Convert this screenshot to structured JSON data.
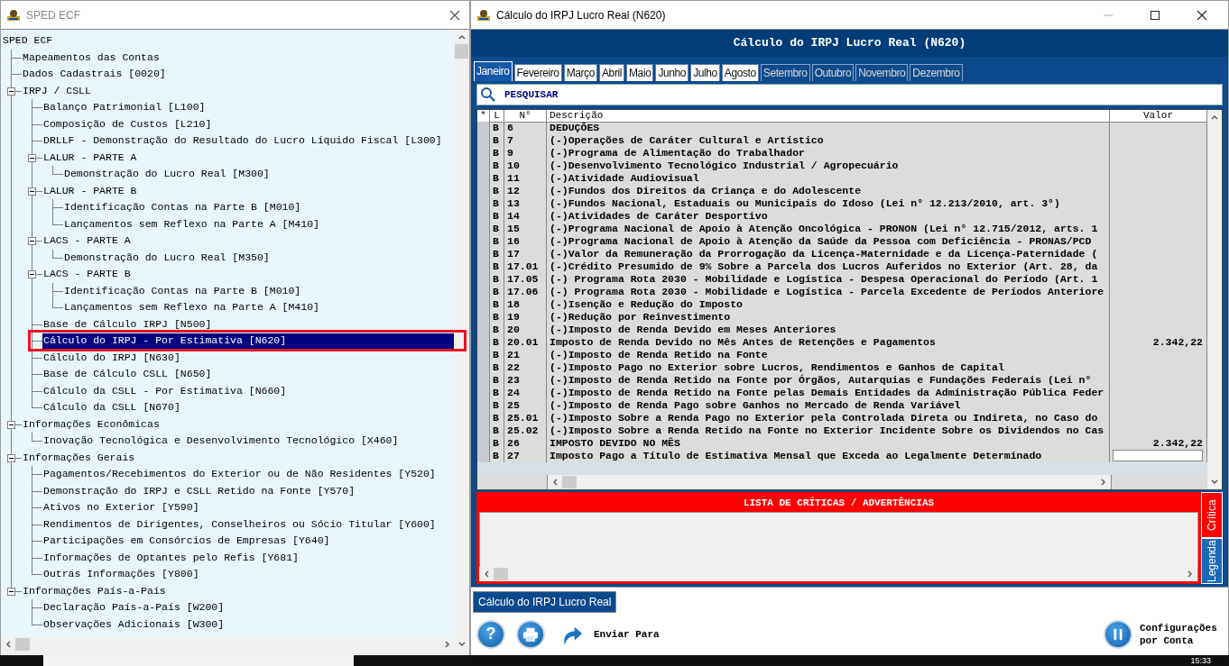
{
  "left_window": {
    "title": "SPED ECF",
    "tree": [
      {
        "label": "SPED ECF",
        "selected": false,
        "children": [
          {
            "label": "Mapeamentos das Contas",
            "selected": false
          },
          {
            "label": "Dados Cadastrais [0020]",
            "selected": false
          },
          {
            "label": "IRPJ / CSLL",
            "selected": false,
            "expanded": true,
            "children": [
              {
                "label": "Balanço Patrimonial [L100]",
                "selected": false
              },
              {
                "label": "Composição de Custos [L210]",
                "selected": false
              },
              {
                "label": "DRLLF - Demonstração do Resultado do Lucro Líquido Fiscal [L300]",
                "selected": false
              },
              {
                "label": "LALUR - PARTE A",
                "selected": false,
                "expanded": true,
                "children": [
                  {
                    "label": "Demonstração do Lucro Real [M300]",
                    "selected": false
                  }
                ]
              },
              {
                "label": "LALUR - PARTE B",
                "selected": false,
                "expanded": true,
                "children": [
                  {
                    "label": "Identificação Contas na Parte B [M010]",
                    "selected": false
                  },
                  {
                    "label": "Lançamentos sem Reflexo na Parte A [M410]",
                    "selected": false
                  }
                ]
              },
              {
                "label": "LACS - PARTE A",
                "selected": false,
                "expanded": true,
                "children": [
                  {
                    "label": "Demonstração do Lucro Real [M350]",
                    "selected": false
                  }
                ]
              },
              {
                "label": "LACS - PARTE B",
                "selected": false,
                "expanded": true,
                "children": [
                  {
                    "label": "Identificação Contas na Parte B [M010]",
                    "selected": false
                  },
                  {
                    "label": "Lançamentos sem Reflexo na Parte A [M410]",
                    "selected": false
                  }
                ]
              },
              {
                "label": "Base de Cálculo IRPJ [N500]",
                "selected": false
              },
              {
                "label": "Cálculo do IRPJ - Por Estimativa [N620]",
                "selected": true
              },
              {
                "label": "Cálculo do IRPJ [N630]",
                "selected": false
              },
              {
                "label": "Base de Cálculo CSLL [N650]",
                "selected": false
              },
              {
                "label": "Cálculo da CSLL - Por Estimativa [N660]",
                "selected": false
              },
              {
                "label": "Cálculo da CSLL [N670]",
                "selected": false
              }
            ]
          },
          {
            "label": "Informações Econômicas",
            "selected": false,
            "expanded": true,
            "children": [
              {
                "label": "Inovação Tecnológica e Desenvolvimento Tecnológico [X460]",
                "selected": false
              }
            ]
          },
          {
            "label": "Informações Gerais",
            "selected": false,
            "expanded": true,
            "children": [
              {
                "label": "Pagamentos/Recebimentos do Exterior ou de Não Residentes [Y520]",
                "selected": false
              },
              {
                "label": "Demonstração do IRPJ e CSLL Retido na Fonte [Y570]",
                "selected": false
              },
              {
                "label": "Ativos no Exterior [Y590]",
                "selected": false
              },
              {
                "label": "Rendimentos de Dirigentes, Conselheiros ou Sócio Titular [Y600]",
                "selected": false
              },
              {
                "label": "Participações em Consórcios de Empresas [Y640]",
                "selected": false
              },
              {
                "label": "Informações de Optantes pelo Refis [Y681]",
                "selected": false
              },
              {
                "label": "Outras Informações [Y800]",
                "selected": false
              }
            ]
          },
          {
            "label": "Informações País-a-País",
            "selected": false,
            "expanded": true,
            "children": [
              {
                "label": "Declaração País-a-País [W200]",
                "selected": false
              },
              {
                "label": "Observações Adicionais [W300]",
                "selected": false
              }
            ]
          }
        ]
      }
    ]
  },
  "right_window": {
    "title": "Cálculo do IRPJ Lucro Real (N620)",
    "header": "Cálculo do IRPJ Lucro Real (N620)",
    "tabs": [
      {
        "label": "Janeiro",
        "selected": true,
        "disabled": false
      },
      {
        "label": "Fevereiro",
        "selected": false,
        "disabled": false
      },
      {
        "label": "Março",
        "selected": false,
        "disabled": false
      },
      {
        "label": "Abril",
        "selected": false,
        "disabled": false
      },
      {
        "label": "Maio",
        "selected": false,
        "disabled": false
      },
      {
        "label": "Junho",
        "selected": false,
        "disabled": false
      },
      {
        "label": "Julho",
        "selected": false,
        "disabled": false
      },
      {
        "label": "Agosto",
        "selected": false,
        "disabled": false
      },
      {
        "label": "Setembro",
        "selected": false,
        "disabled": true
      },
      {
        "label": "Outubro",
        "selected": false,
        "disabled": true
      },
      {
        "label": "Novembro",
        "selected": false,
        "disabled": true
      },
      {
        "label": "Dezembro",
        "selected": false,
        "disabled": true
      }
    ],
    "search": {
      "placeholder": "PESQUISAR"
    },
    "table": {
      "columns": [
        "*",
        "L",
        "N°",
        "Descrição",
        "Valor"
      ],
      "rows": [
        {
          "kind": "text",
          "l": "B",
          "number": "6",
          "description": "DEDUÇÕES"
        },
        {
          "kind": "text",
          "l": "B",
          "number": "7",
          "description": "(-)Operações de Caráter Cultural e Artístico"
        },
        {
          "kind": "text",
          "l": "B",
          "number": "9",
          "description": "(-)Programa de Alimentação do Trabalhador"
        },
        {
          "kind": "text",
          "l": "B",
          "number": "10",
          "description": "(-)Desenvolvimento Tecnológico Industrial / Agropecuário"
        },
        {
          "kind": "text",
          "l": "B",
          "number": "11",
          "description": "(-)Atividade Audiovisual"
        },
        {
          "kind": "text",
          "l": "B",
          "number": "12",
          "description": "(-)Fundos dos Direitos da Criança e do Adolescente"
        },
        {
          "kind": "text",
          "l": "B",
          "number": "13",
          "description": "(-)Fundos Nacional, Estaduais ou Municipais do Idoso (Lei n° 12.213/2010, art. 3°)"
        },
        {
          "kind": "text",
          "l": "B",
          "number": "14",
          "description": "(-)Atividades de Caráter Desportivo"
        },
        {
          "kind": "text",
          "l": "B",
          "number": "15",
          "description": "(-)Programa Nacional de Apoio à Atenção Oncológica - PRONON (Lei n° 12.715/2012, arts. 1"
        },
        {
          "kind": "text",
          "l": "B",
          "number": "16",
          "description": "(-)Programa Nacional de Apoio à Atenção da Saúde da Pessoa com Deficiência - PRONAS/PCD"
        },
        {
          "kind": "text",
          "l": "B",
          "number": "17",
          "description": "(-)Valor da Remuneração da Prorrogação da Licença-Maternidade e da Licença-Paternidade ("
        },
        {
          "kind": "text",
          "l": "B",
          "number": "17.01",
          "description": "(-)Crédito Presumido de 9% Sobre a Parcela dos Lucros Auferidos no Exterior (Art. 28, da"
        },
        {
          "kind": "text",
          "l": "B",
          "number": "17.05",
          "description": "(-) Programa Rota 2030 - Mobilidade e Logística - Despesa Operacional do Período (Art. 1"
        },
        {
          "kind": "text",
          "l": "B",
          "number": "17.06",
          "description": "(-) Programa Rota 2030 - Mobilidade e Logística - Parcela Excedente de Períodos Anteriore"
        },
        {
          "kind": "text",
          "l": "B",
          "number": "18",
          "description": "(-)Isenção e Redução do Imposto"
        },
        {
          "kind": "text",
          "l": "B",
          "number": "19",
          "description": "(-)Redução por Reinvestimento"
        },
        {
          "kind": "text",
          "l": "B",
          "number": "20",
          "description": "(-)Imposto de Renda Devido em Meses Anteriores"
        },
        {
          "kind": "text",
          "l": "B",
          "number": "20.01",
          "description": "Imposto de Renda Devido no Mês Antes de Retenções e Pagamentos",
          "value": "2.342,22"
        },
        {
          "kind": "text",
          "l": "B",
          "number": "21",
          "description": "(-)Imposto de Renda Retido na Fonte"
        },
        {
          "kind": "text",
          "l": "B",
          "number": "22",
          "description": "(-)Imposto Pago no Exterior sobre Lucros, Rendimentos e Ganhos de Capital"
        },
        {
          "kind": "text",
          "l": "B",
          "number": "23",
          "description": "(-)Imposto de Renda Retido na Fonte por Órgãos, Autarquias e Fundações Federais (Lei n°"
        },
        {
          "kind": "text",
          "l": "B",
          "number": "24",
          "description": "(-)Imposto de Renda Retido na Fonte pelas Demais Entidades da Administração Pública Feder"
        },
        {
          "kind": "text",
          "l": "B",
          "number": "25",
          "description": "(-)Imposto de Renda Pago sobre Ganhos no Mercado de Renda Variável"
        },
        {
          "kind": "text",
          "l": "B",
          "number": "25.01",
          "description": "(-)Imposto Sobre a Renda Pago no Exterior pela Controlada Direta ou Indireta, no Caso do"
        },
        {
          "kind": "text",
          "l": "B",
          "number": "25.02",
          "description": "(-)Imposto Sobre a Renda Retido na Fonte no Exterior Incidente Sobre os Dividendos no Cas"
        },
        {
          "kind": "text",
          "l": "B",
          "number": "26",
          "description": "IMPOSTO DEVIDO NO MÊS",
          "value": "2.342,22"
        },
        {
          "kind": "input",
          "l": "B",
          "number": "27",
          "description": "Imposto Pago a Título de Estimativa Mensal que Exceda ao Legalmente Determinado"
        }
      ]
    },
    "alerts": {
      "title": "LISTA DE CRÍTICAS / ADVERTÊNCIAS",
      "side_tabs": [
        {
          "label": "Crítica",
          "selected": true
        },
        {
          "label": "Legenda",
          "selected": false
        }
      ]
    },
    "document_tabs": [
      {
        "label": "Cálculo do IRPJ Lucro Real",
        "selected": true
      }
    ],
    "toolbar": {
      "help_glyph": "?",
      "send_label": "Enviar Para",
      "settings_label": "Configurações por Conta"
    }
  },
  "taskbar": {
    "clock": "15:33"
  }
}
